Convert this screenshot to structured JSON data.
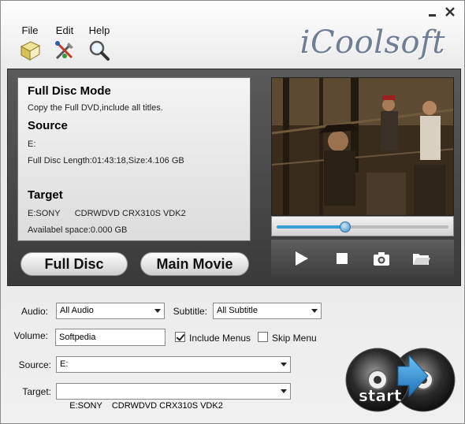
{
  "brand": "iCoolsoft",
  "menu": {
    "file": "File",
    "edit": "Edit",
    "help": "Help"
  },
  "icons": {
    "minimize": "minimize-icon",
    "close": "close-icon",
    "file": "book-icon",
    "edit": "tools-icon",
    "help": "magnifier-icon"
  },
  "info": {
    "mode_title": "Full Disc Mode",
    "mode_desc": "Copy the Full DVD,include all titles.",
    "source_title": "Source",
    "source_drive": "E:",
    "source_detail": "Full Disc Length:01:43:18,Size:4.106 GB",
    "target_title": "Target",
    "target_drive": "E:SONY      CDRWDVD CRX310S VDK2",
    "target_space": "Availabel space:0.000 GB"
  },
  "mode_buttons": {
    "full_disc": "Full Disc",
    "main_movie": "Main Movie"
  },
  "player": {
    "progress": 0.4
  },
  "form": {
    "audio_label": "Audio:",
    "audio_value": "All Audio",
    "subtitle_label": "Subtitle:",
    "subtitle_value": "All Subtitle",
    "volume_label": "Volume:",
    "volume_value": "Softpedia",
    "include_menus_label": "Include Menus",
    "include_menus_checked": true,
    "skip_menu_label": "Skip Menu",
    "skip_menu_checked": false,
    "source_label": "Source:",
    "source_value": "E:",
    "target_label": "Target:",
    "target_value": "E:SONY    CDRWDVD CRX310S VDK2"
  },
  "start_label": "start",
  "colors": {
    "accent": "#39a0d6",
    "brand": "#6f7e95",
    "panel_dark": "#3e3e3e"
  }
}
